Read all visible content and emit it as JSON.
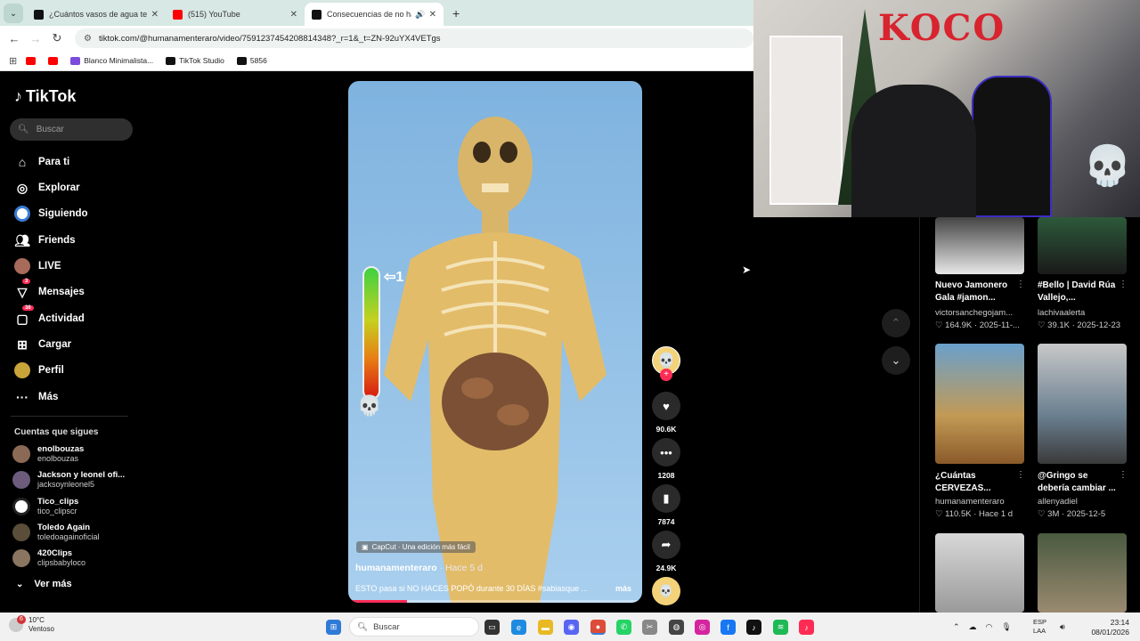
{
  "browser": {
    "tabs": [
      {
        "title": "¿Cuántos vasos de agua te lleva",
        "active": false
      },
      {
        "title": "(515) YouTube",
        "active": false
      },
      {
        "title": "Consecuencias de no hace",
        "active": true
      }
    ],
    "url": "tiktok.com/@humanamenteraro/video/7591237454208814348?_r=1&_t=ZN-92uYX4VETgs",
    "bookmarks": [
      "Blanco Minimalista...",
      "TikTok Studio",
      "5856"
    ]
  },
  "tiktok": {
    "logo": "TikTok",
    "search_placeholder": "Buscar",
    "nav": [
      {
        "label": "Para ti",
        "icon": "home-icon"
      },
      {
        "label": "Explorar",
        "icon": "compass-icon"
      },
      {
        "label": "Siguiendo",
        "icon": "following-icon"
      },
      {
        "label": "Friends",
        "icon": "friends-icon"
      },
      {
        "label": "LIVE",
        "icon": "live-icon"
      },
      {
        "label": "Mensajes",
        "icon": "messages-icon",
        "badge": "3"
      },
      {
        "label": "Actividad",
        "icon": "activity-icon",
        "badge": "36"
      },
      {
        "label": "Cargar",
        "icon": "upload-icon"
      },
      {
        "label": "Perfil",
        "icon": "profile-icon"
      },
      {
        "label": "Más",
        "icon": "more-icon"
      }
    ],
    "following_header": "Cuentas que sigues",
    "following": [
      {
        "name": "enolbouzas",
        "handle": "enolbouzas"
      },
      {
        "name": "Jackson y leonel ofi...",
        "handle": "jacksoynleonel5"
      },
      {
        "name": "Tico_clips",
        "handle": "tico_clipscr"
      },
      {
        "name": "Toledo Again",
        "handle": "toledoagainoficial"
      },
      {
        "name": "420Clips",
        "handle": "clipsbabyloco"
      }
    ],
    "see_more": "Ver más",
    "video": {
      "capcut": "CapCut · Una edición más fácil",
      "author": "humanamenteraro",
      "ago": " · Hace 5 d",
      "description": "ESTO pasa si NO HACES POPÓ durante 30 DÍAS #sabiasque ...",
      "more": "más",
      "overlay_label": "1",
      "progress": 0.2
    },
    "actions": {
      "likes": "90.6K",
      "comments": "1208",
      "saves": "7874",
      "shares": "24.9K"
    },
    "recommended": [
      {
        "title": "Nuevo Jamonero Gala #jamon...",
        "author": "victorsanchegojam...",
        "stats": "♡ 164.9K · 2025-11-..."
      },
      {
        "title": "#Bello | David Rúa Vallejo,...",
        "author": "lachivaalerta",
        "stats": "♡ 39.1K · 2025-12-23"
      },
      {
        "title": "¿Cuántas CERVEZAS...",
        "author": "humanamenteraro",
        "stats": "♡ 110.5K · Hace 1 d"
      },
      {
        "title": "@Gringo se debería cambiar ...",
        "author": "allenyadiel",
        "stats": "♡ 3M · 2025-12-5"
      }
    ]
  },
  "webcam": {
    "graffiti": "KOCO"
  },
  "taskbar": {
    "weather_temp": "10°C",
    "weather_desc": "Ventoso",
    "weather_badge": "6",
    "search": "Buscar",
    "lang_top": "ESP",
    "lang_bottom": "LAA",
    "time": "23:14",
    "date": "08/01/2026"
  }
}
